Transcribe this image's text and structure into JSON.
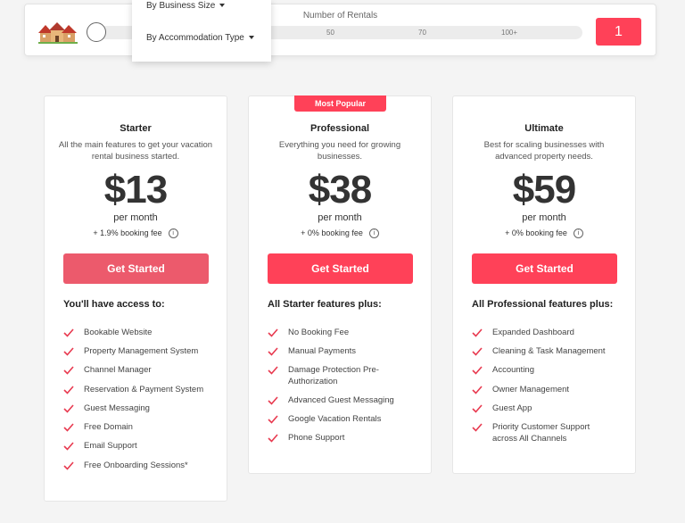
{
  "slider": {
    "title": "Number of Rentals",
    "ticks": [
      "50",
      "70",
      "100+"
    ],
    "value": "1",
    "position_fraction": 0,
    "icon": "houses-icon"
  },
  "dropdown": {
    "items": [
      "By Business Size",
      "By Accommodation Type"
    ]
  },
  "plans": [
    {
      "name": "Starter",
      "description": "All the main features to get your vacation rental business started.",
      "price": "$13",
      "period": "per month",
      "fee": "+ 1.9% booking fee",
      "cta": "Get Started",
      "features_heading": "You'll have access to:",
      "features": [
        "Bookable Website",
        "Property Management System",
        "Channel Manager",
        "Reservation & Payment System",
        "Guest Messaging",
        "Free Domain",
        "Email Support",
        "Free Onboarding Sessions*"
      ]
    },
    {
      "name": "Professional",
      "badge": "Most Popular",
      "description": "Everything you need for growing businesses.",
      "price": "$38",
      "period": "per month",
      "fee": "+ 0% booking fee",
      "cta": "Get Started",
      "features_heading": "All Starter features plus:",
      "features": [
        "No Booking Fee",
        "Manual Payments",
        "Damage Protection Pre-Authorization",
        "Advanced Guest Messaging",
        "Google Vacation Rentals",
        "Phone Support"
      ]
    },
    {
      "name": "Ultimate",
      "description": "Best for scaling businesses with advanced property needs.",
      "price": "$59",
      "period": "per month",
      "fee": "+ 0% booking fee",
      "cta": "Get Started",
      "features_heading": "All Professional features plus:",
      "features": [
        "Expanded Dashboard",
        "Cleaning & Task Management",
        "Accounting",
        "Owner Management",
        "Guest App",
        "Priority Customer Support across All Channels"
      ]
    }
  ],
  "colors": {
    "accent": "#ff4158",
    "accent_faded": "#ec5a6c",
    "check": "#e8394f"
  }
}
